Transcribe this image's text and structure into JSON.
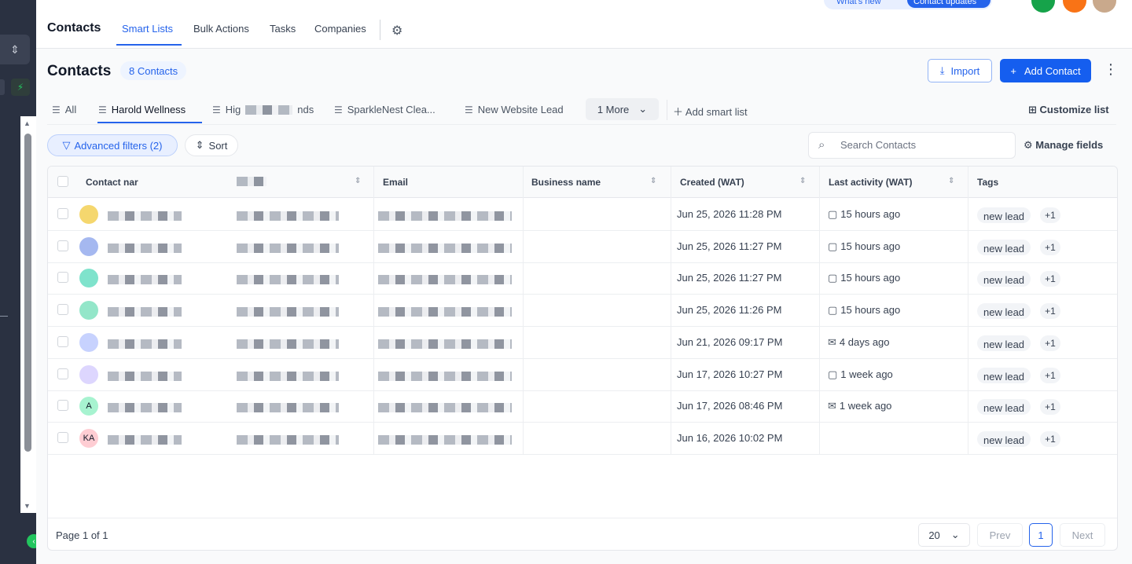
{
  "nav": {
    "title": "Contacts",
    "tabs": [
      "Smart Lists",
      "Bulk Actions",
      "Tasks",
      "Companies"
    ],
    "whats_new": "What's new",
    "updates_pill": "Contact updates"
  },
  "header": {
    "title": "Contacts",
    "count_label": "8 Contacts",
    "import_label": "Import",
    "add_label": "Add Contact"
  },
  "smart_lists": {
    "tabs": [
      "All",
      "Harold Wellness",
      "Hig",
      "nds",
      "SparkleNest Clea...",
      "New Website Lead"
    ],
    "more_label": "1 More",
    "add_label": "Add smart list",
    "customize_label": "Customize list"
  },
  "filters": {
    "advanced_label": "Advanced filters (2)",
    "sort_label": "Sort",
    "search_placeholder": "Search Contacts",
    "manage_fields_label": "Manage fields"
  },
  "table": {
    "columns": [
      "Contact nar",
      "Email",
      "Business name",
      "Created (WAT)",
      "Last activity (WAT)",
      "Tags"
    ],
    "rows": [
      {
        "avatar": "",
        "avatar_color": "#f5d76e",
        "created": "Jun 25, 2026 11:28 PM",
        "activity": "15 hours ago",
        "activity_icon": "chat",
        "tag": "new lead",
        "more": "+1"
      },
      {
        "avatar": "",
        "avatar_color": "#a5b8f0",
        "created": "Jun 25, 2026 11:27 PM",
        "activity": "15 hours ago",
        "activity_icon": "chat",
        "tag": "new lead",
        "more": "+1"
      },
      {
        "avatar": "",
        "avatar_color": "#7fe3cc",
        "created": "Jun 25, 2026 11:27 PM",
        "activity": "15 hours ago",
        "activity_icon": "chat",
        "tag": "new lead",
        "more": "+1"
      },
      {
        "avatar": "",
        "avatar_color": "#93e6c9",
        "created": "Jun 25, 2026 11:26 PM",
        "activity": "15 hours ago",
        "activity_icon": "chat",
        "tag": "new lead",
        "more": "+1"
      },
      {
        "avatar": "",
        "avatar_color": "#c7d2fe",
        "created": "Jun 21, 2026 09:17 PM",
        "activity": "4 days ago",
        "activity_icon": "mail",
        "tag": "new lead",
        "more": "+1"
      },
      {
        "avatar": "",
        "avatar_color": "#ddd6fe",
        "created": "Jun 17, 2026 10:27 PM",
        "activity": "1 week ago",
        "activity_icon": "chat",
        "tag": "new lead",
        "more": "+1"
      },
      {
        "avatar": "A",
        "avatar_color": "#a7f3d0",
        "created": "Jun 17, 2026 08:46 PM",
        "activity": "1 week ago",
        "activity_icon": "mail",
        "tag": "new lead",
        "more": "+1"
      },
      {
        "avatar": "KA",
        "avatar_color": "#fecdd3",
        "created": "Jun 16, 2026 10:02 PM",
        "activity": "",
        "activity_icon": "",
        "tag": "new lead",
        "more": "+1"
      }
    ]
  },
  "pagination": {
    "info": "Page 1 of 1",
    "per_page": "20",
    "prev_label": "Prev",
    "page": "1",
    "next_label": "Next"
  },
  "colors": {
    "accent": "#2563eb",
    "sidebar": "#2a3141"
  }
}
